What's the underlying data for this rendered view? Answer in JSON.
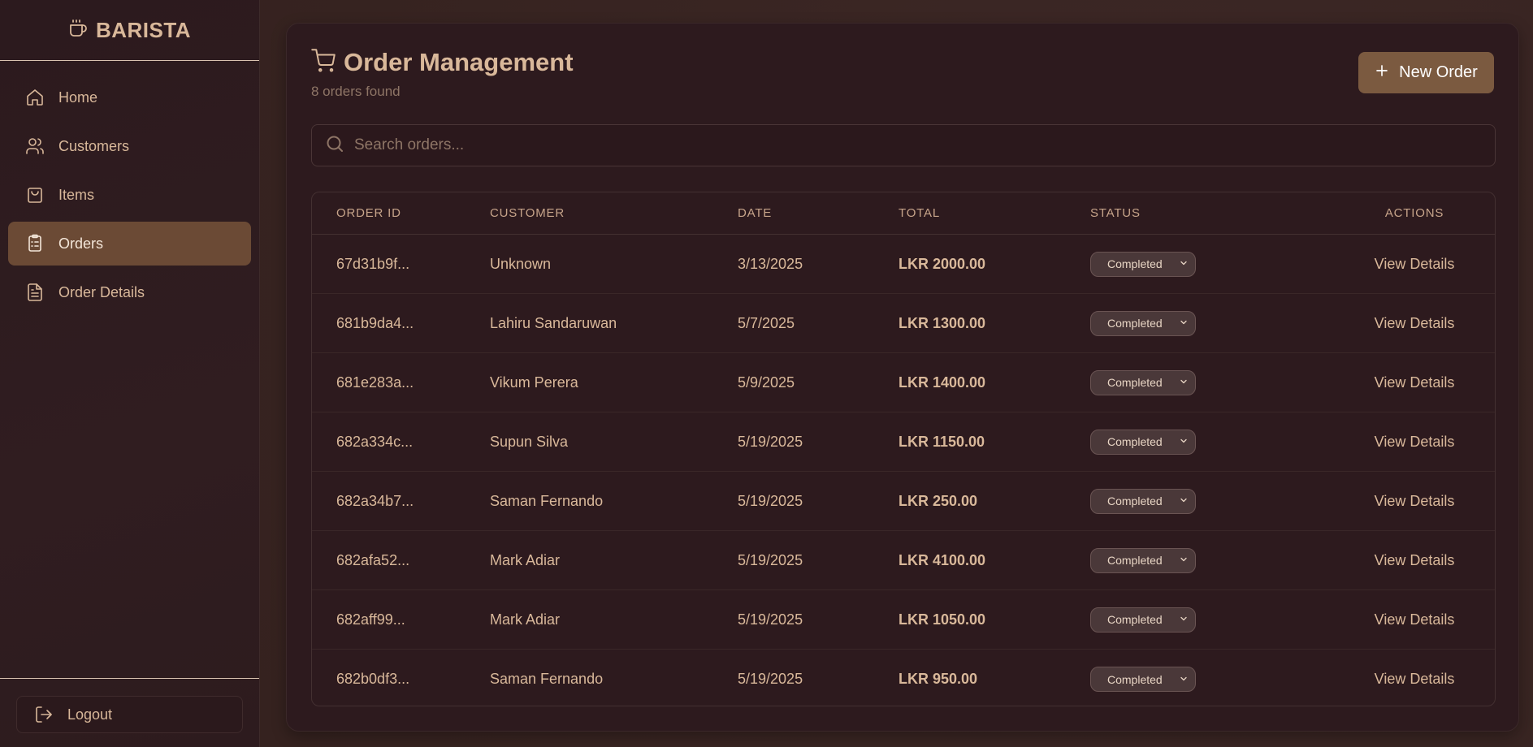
{
  "brand": {
    "name": "BARISTA",
    "icon": "coffee-cup-icon"
  },
  "sidebar": {
    "items": [
      {
        "label": "Home",
        "icon": "home-icon",
        "active": false
      },
      {
        "label": "Customers",
        "icon": "users-icon",
        "active": false
      },
      {
        "label": "Items",
        "icon": "shopping-bag-icon",
        "active": false
      },
      {
        "label": "Orders",
        "icon": "clipboard-list-icon",
        "active": true
      },
      {
        "label": "Order Details",
        "icon": "file-text-icon",
        "active": false
      }
    ],
    "logout_label": "Logout"
  },
  "page": {
    "title": "Order Management",
    "subtitle": "8 orders found",
    "new_order_label": "New Order"
  },
  "search": {
    "placeholder": "Search orders...",
    "value": ""
  },
  "table": {
    "headers": [
      "ORDER ID",
      "CUSTOMER",
      "DATE",
      "TOTAL",
      "STATUS",
      "ACTIONS"
    ],
    "rows": [
      {
        "id": "67d31b9f...",
        "customer": "Unknown",
        "date": "3/13/2025",
        "total": "LKR 2000.00",
        "status": "Completed",
        "action": "View Details"
      },
      {
        "id": "681b9da4...",
        "customer": "Lahiru Sandaruwan",
        "date": "5/7/2025",
        "total": "LKR 1300.00",
        "status": "Completed",
        "action": "View Details"
      },
      {
        "id": "681e283a...",
        "customer": "Vikum Perera",
        "date": "5/9/2025",
        "total": "LKR 1400.00",
        "status": "Completed",
        "action": "View Details"
      },
      {
        "id": "682a334c...",
        "customer": "Supun Silva",
        "date": "5/19/2025",
        "total": "LKR 1150.00",
        "status": "Completed",
        "action": "View Details"
      },
      {
        "id": "682a34b7...",
        "customer": "Saman Fernando",
        "date": "5/19/2025",
        "total": "LKR 250.00",
        "status": "Completed",
        "action": "View Details"
      },
      {
        "id": "682afa52...",
        "customer": "Mark Adiar",
        "date": "5/19/2025",
        "total": "LKR 4100.00",
        "status": "Completed",
        "action": "View Details"
      },
      {
        "id": "682aff99...",
        "customer": "Mark Adiar",
        "date": "5/19/2025",
        "total": "LKR 1050.00",
        "status": "Completed",
        "action": "View Details"
      },
      {
        "id": "682b0df3...",
        "customer": "Saman Fernando",
        "date": "5/19/2025",
        "total": "LKR 950.00",
        "status": "Completed",
        "action": "View Details"
      }
    ]
  },
  "colors": {
    "accent": "#7b5a40",
    "active_nav": "#6b4a35",
    "text": "#d9b89a",
    "muted": "#8e7566",
    "card": "#2d1a1e"
  }
}
